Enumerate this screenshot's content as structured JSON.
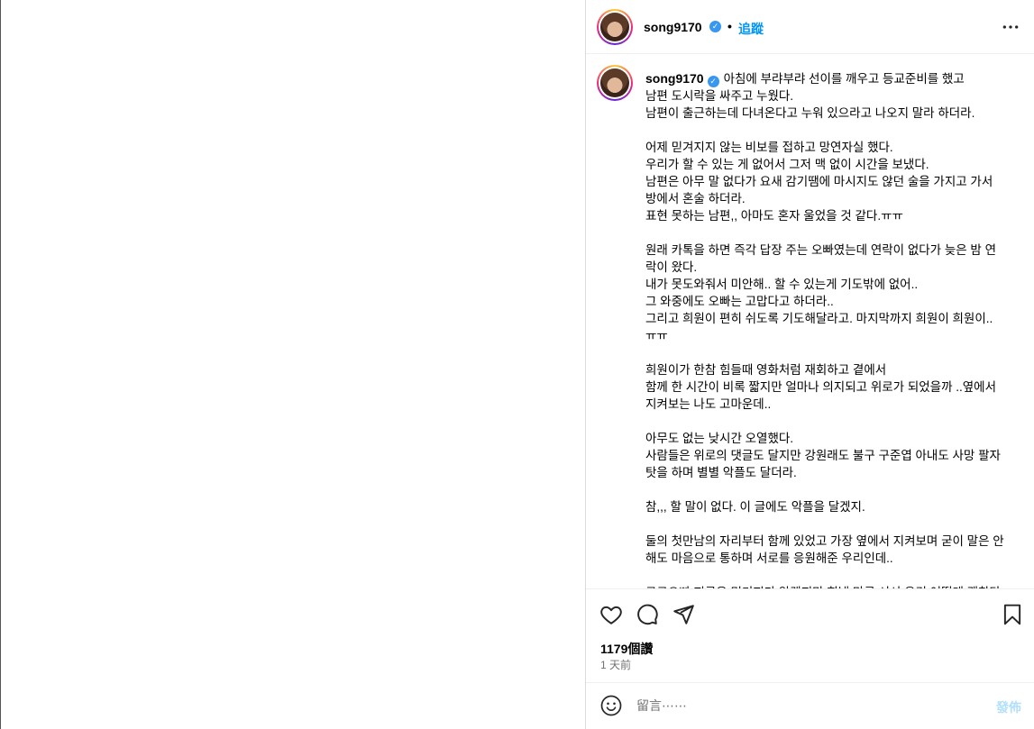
{
  "header": {
    "username": "song9170",
    "dot": "•",
    "follow_label": "追蹤"
  },
  "caption": {
    "username": "song9170",
    "text": "아침에 부랴부랴 선이를 깨우고 등교준비를 했고\n남편 도시락을 싸주고 누웠다.\n남편이 출근하는데 다녀온다고 누워 있으라고 나오지 말라 하더라.\n\n어제 믿겨지지 않는 비보를 접하고 망연자실 했다.\n우리가 할 수 있는 게 없어서 그저 맥 없이 시간을 보냈다.\n남편은 아무 말 없다가 요새 감기땜에 마시지도 않던 술을 가지고 가서 방에서 혼술 하더라.\n표현 못하는 남편,, 아마도 혼자 울었을 것 같다.ㅠㅠ\n\n원래 카톡을 하면 즉각 답장 주는 오빠였는데 연락이 없다가 늦은 밤 연락이 왔다.\n내가 못도와줘서 미안해.. 할 수 있는게 기도밖에 없어..\n그 와중에도 오빠는 고맙다고 하더라..\n그리고 희원이 편히 쉬도록 기도해달라고. 마지막까지 희원이 희원이.. ㅠㅠ\n\n희원이가 한참 힘들때 영화처럼 재회하고 곁에서\n함께 한 시간이 비록 짧지만 얼마나 의지되고 위로가 되었을까 ..옆에서 지켜보는 나도 고마운데..\n\n아무도 없는 낮시간 오열했다.\n사람들은 위로의 댓글도 달지만 강원래도 불구 구준엽 아내도 사망 팔자탓을 하며 별별 악플도 달더라.\n\n참,,, 할 말이 없다. 이 글에도 악플을 달겠지.\n\n둘의 첫만남의 자리부터 함께 있었고 가장 옆에서 지켜보며 굳이 말은 안해도 마음으로 통하며 서로를 응원해준 우리인데..\n\n구구오빠 지금은 믿기지가 않겠지만 힘낼 만큼 서서 우리 어떻게 괜찮다고"
  },
  "actions": {
    "likes": "1179個讚",
    "time": "1 天前"
  },
  "comment": {
    "placeholder": "留言⋯⋯",
    "post_label": "發佈"
  }
}
